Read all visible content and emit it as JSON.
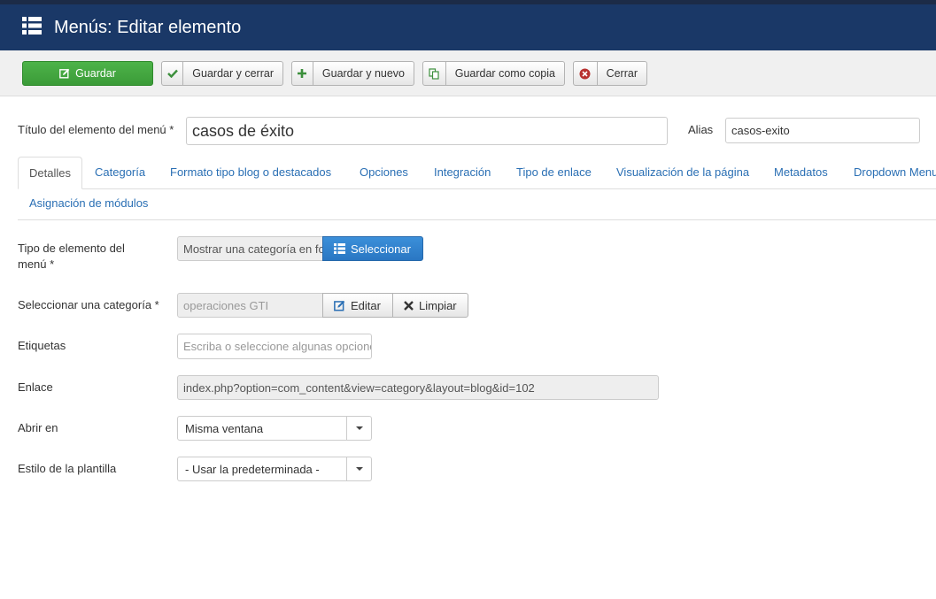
{
  "header": {
    "title": "Menús: Editar elemento",
    "icon": "list-icon"
  },
  "toolbar": {
    "save": "Guardar",
    "save_close": "Guardar y cerrar",
    "save_new": "Guardar y nuevo",
    "save_copy": "Guardar como copia",
    "close": "Cerrar"
  },
  "form": {
    "title_label": "Título del elemento del menú *",
    "title_value": "casos de éxito",
    "alias_label": "Alias",
    "alias_value": "casos-exito"
  },
  "tabs": [
    "Detalles",
    "Categoría",
    "Formato tipo blog o destacados",
    "Opciones",
    "Integración",
    "Tipo de enlace",
    "Visualización de la página",
    "Metadatos",
    "Dropdown Menu",
    "Asignación de módulos"
  ],
  "fields": {
    "type_label_1": "Tipo de elemento del",
    "type_label_2": "menú *",
    "type_value": "Mostrar una categoría en forma de blog",
    "select_button": "Seleccionar",
    "category_label": "Seleccionar una categoría *",
    "category_value": "operaciones GTI",
    "edit_button": "Editar",
    "clear_button": "Limpiar",
    "tags_label": "Etiquetas",
    "tags_placeholder": "Escriba o seleccione algunas opciones",
    "link_label": "Enlace",
    "link_value": "index.php?option=com_content&view=category&layout=blog&id=102",
    "open_label": "Abrir en",
    "open_value": "Misma ventana",
    "style_label": "Estilo de la plantilla",
    "style_value": "- Usar la predeterminada -"
  },
  "colors": {
    "header": "#1a3867",
    "primary_green": "#46a546",
    "primary_blue": "#2a77c3",
    "link": "#2a6fb4"
  }
}
